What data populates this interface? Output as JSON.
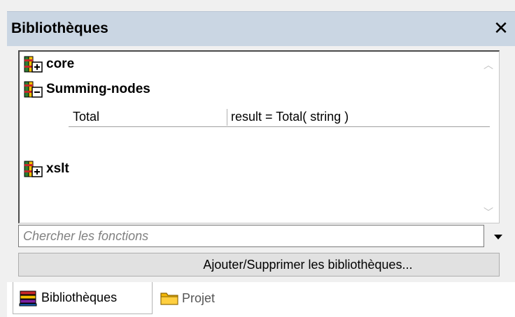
{
  "window": {
    "title": "Bibliothèques",
    "close_label": "✕"
  },
  "libraries": [
    {
      "name": "core",
      "state": "collapsed",
      "icon": "library-expand-icon"
    },
    {
      "name": "Summing-nodes",
      "state": "expanded",
      "icon": "library-collapse-icon",
      "functions": [
        {
          "name": "Total",
          "signature": "result = Total( string )"
        }
      ]
    },
    {
      "name": "xslt",
      "state": "collapsed",
      "icon": "library-expand-icon"
    }
  ],
  "search": {
    "placeholder": "Chercher les fonctions",
    "value": ""
  },
  "add_remove_button": "Ajouter/Supprimer les bibliothèques...",
  "tabs": [
    {
      "label": "Bibliothèques",
      "active": true,
      "icon": "libraries-tab-icon"
    },
    {
      "label": "Projet",
      "active": false,
      "icon": "folder-icon"
    }
  ],
  "colors": {
    "titlebar_bg": "#cad6e3",
    "panel_bg": "#f0f0f0"
  }
}
